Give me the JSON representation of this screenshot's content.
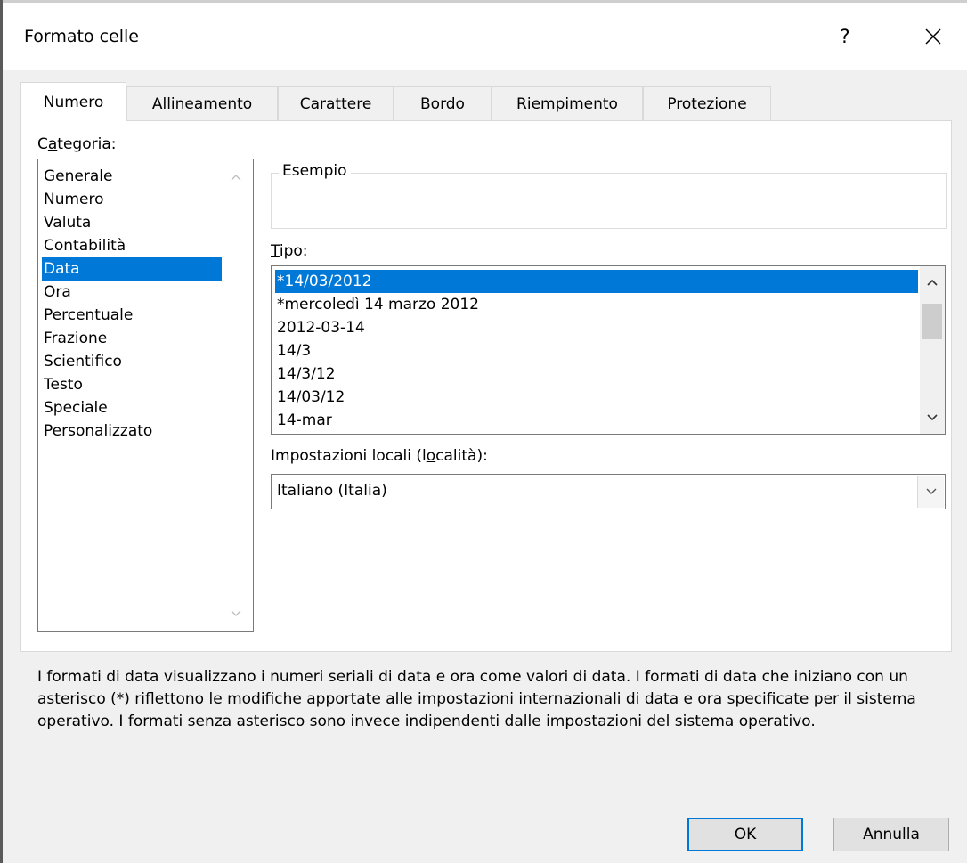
{
  "dialog": {
    "title": "Formato celle",
    "help_label": "?"
  },
  "tabs": [
    {
      "label": "Numero",
      "active": true
    },
    {
      "label": "Allineamento"
    },
    {
      "label": "Carattere"
    },
    {
      "label": "Bordo"
    },
    {
      "label": "Riempimento"
    },
    {
      "label": "Protezione"
    }
  ],
  "category": {
    "label_pre": "C",
    "label_u": "a",
    "label_post": "tegoria:",
    "items": [
      "Generale",
      "Numero",
      "Valuta",
      "Contabilità",
      "Data",
      "Ora",
      "Percentuale",
      "Frazione",
      "Scientifico",
      "Testo",
      "Speciale",
      "Personalizzato"
    ],
    "selected": "Data"
  },
  "esempio": {
    "label": "Esempio",
    "value": ""
  },
  "tipo": {
    "label_u": "T",
    "label_post": "ipo:",
    "items": [
      "*14/03/2012",
      "*mercoledì 14 marzo 2012",
      "2012-03-14",
      "14/3",
      "14/3/12",
      "14/03/12",
      "14-mar"
    ],
    "selected": "*14/03/2012"
  },
  "locale": {
    "label_pre": "Impostazioni locali (l",
    "label_u": "o",
    "label_post": "calità):",
    "value": "Italiano (Italia)"
  },
  "description": "I formati di data visualizzano i numeri seriali di data e ora come valori di data. I formati di data che iniziano con un asterisco (*) riflettono le modifiche apportate alle impostazioni internazionali di data e ora specificate per il sistema operativo. I formati senza asterisco sono invece indipendenti dalle impostazioni del sistema operativo.",
  "buttons": {
    "ok": "OK",
    "cancel": "Annulla"
  },
  "colors": {
    "selection": "#0078d7",
    "dialog_bg": "#f0f0f0",
    "panel_bg": "#ffffff"
  }
}
